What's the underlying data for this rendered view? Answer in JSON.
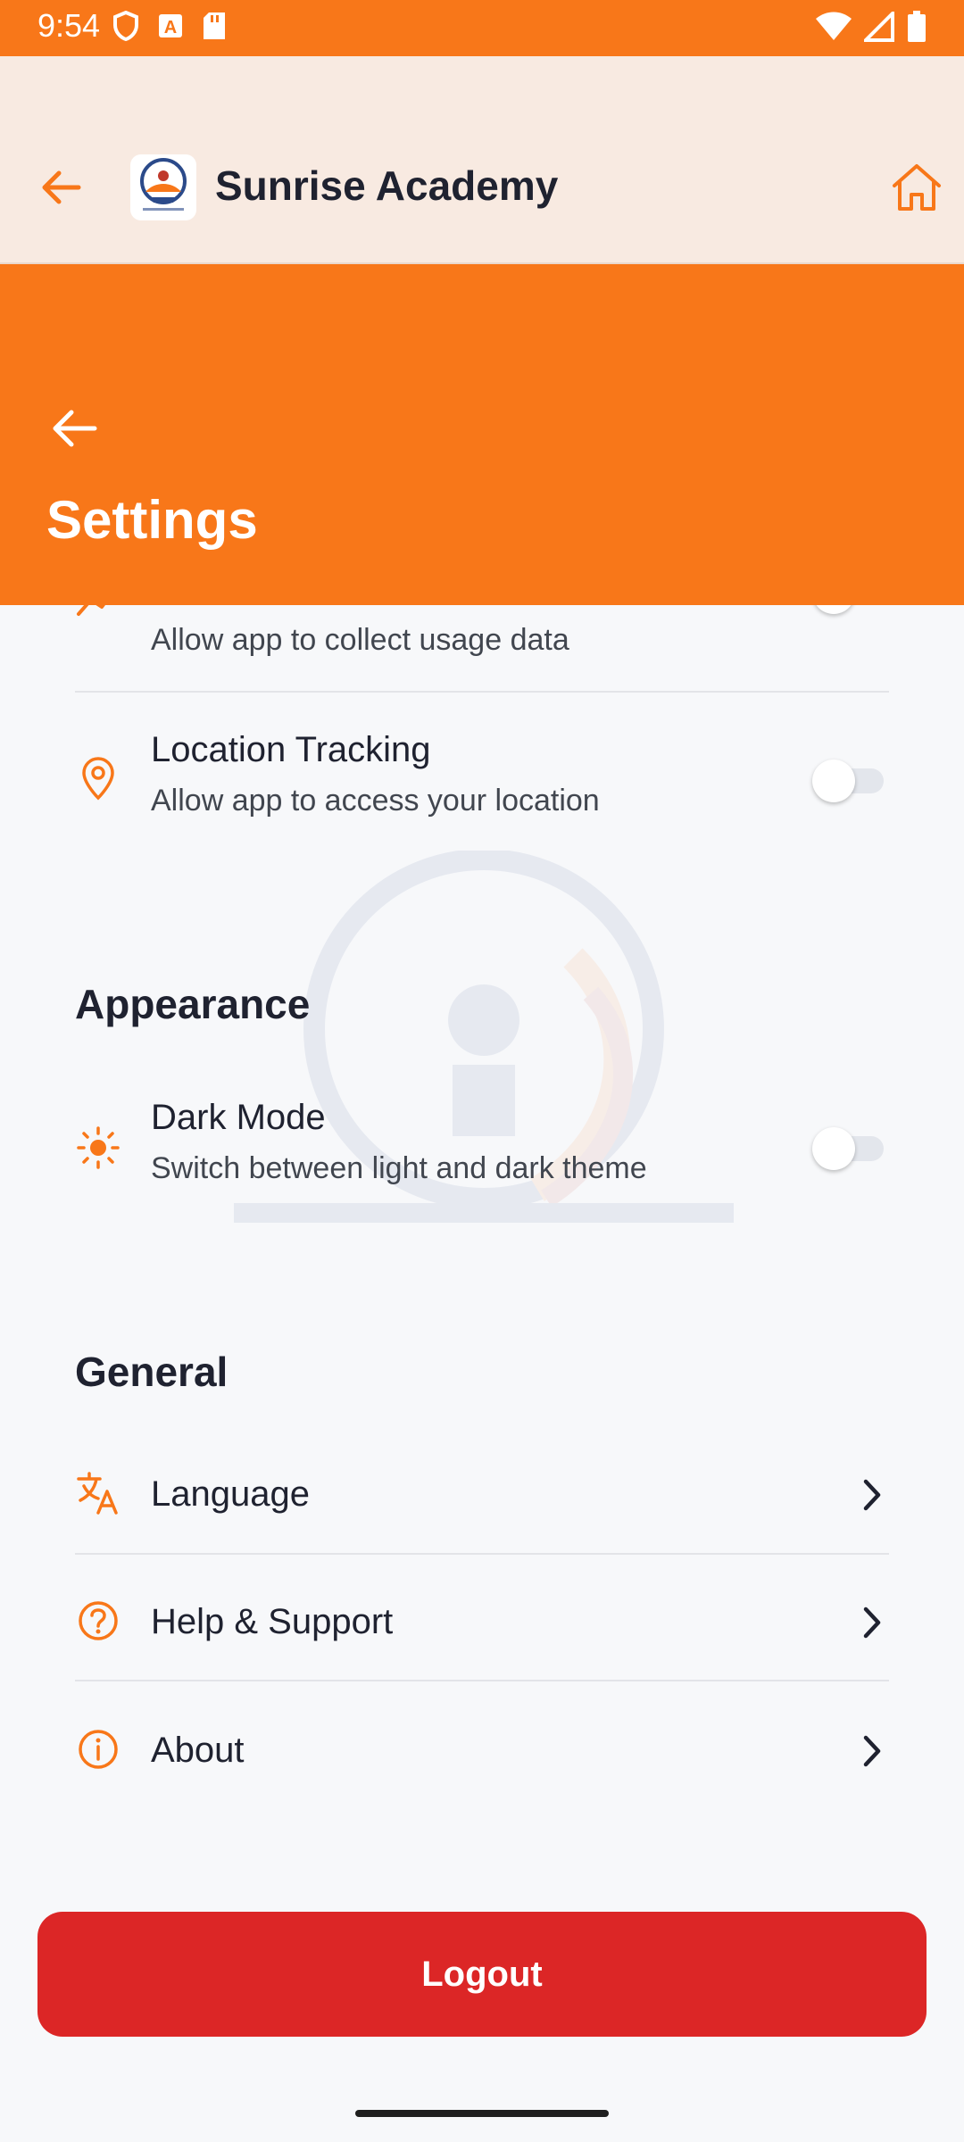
{
  "status_bar": {
    "time": "9:54"
  },
  "app_bar": {
    "title": "Sunrise Academy"
  },
  "hero": {
    "title": "Settings"
  },
  "privacy": {
    "usage_data": {
      "subtitle": "Allow app to collect usage data",
      "enabled": false
    },
    "location": {
      "title": "Location Tracking",
      "subtitle": "Allow app to access your location",
      "enabled": false
    }
  },
  "appearance": {
    "heading": "Appearance",
    "dark_mode": {
      "title": "Dark Mode",
      "subtitle": "Switch between light and dark theme",
      "enabled": false
    }
  },
  "general": {
    "heading": "General",
    "items": [
      {
        "label": "Language",
        "icon": "translate-icon"
      },
      {
        "label": "Help & Support",
        "icon": "help-circle-icon"
      },
      {
        "label": "About",
        "icon": "info-icon"
      }
    ]
  },
  "logout_label": "Logout",
  "colors": {
    "primary": "#f87719",
    "danger": "#dc2626",
    "appbar_bg": "#f8eae1",
    "page_bg": "#f7f8fa"
  }
}
